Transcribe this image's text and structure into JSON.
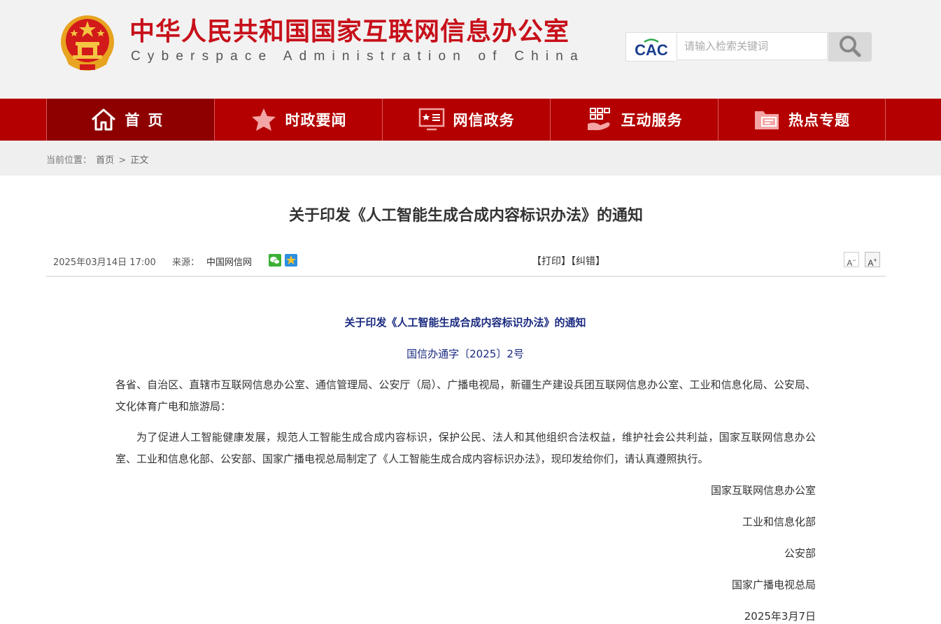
{
  "header": {
    "title_cn": "中华人民共和国国家互联网信息办公室",
    "title_en": "Cyberspace Administration of China",
    "search_logo": "CAC",
    "search_placeholder": "请输入检索关键词",
    "emblem_icon": "national-emblem-icon",
    "search_icon": "search-icon"
  },
  "colors": {
    "brand_red": "#c7101a",
    "nav_bg": "#b40000",
    "nav_active": "#8e0000",
    "doc_blue": "#1a2a80"
  },
  "nav": {
    "items": [
      {
        "label": "首页",
        "icon": "home-icon"
      },
      {
        "label": "时政要闻",
        "icon": "star-icon"
      },
      {
        "label": "网信政务",
        "icon": "monitor-icon"
      },
      {
        "label": "互动服务",
        "icon": "service-hand-icon"
      },
      {
        "label": "热点专题",
        "icon": "folder-icon"
      }
    ]
  },
  "breadcrumb": {
    "prefix": "当前位置：",
    "home": "首页",
    "sep": ">",
    "current": "正文"
  },
  "article": {
    "title": "关于印发《人工智能生成合成内容标识办法》的通知",
    "date": "2025年03月14日 17:00",
    "source_label": "来源：",
    "source": "中国网信网",
    "print": "【打印】",
    "correct": "【纠错】",
    "font_minus": "A",
    "font_plus": "A",
    "doc_title": "关于印发《人工智能生成合成内容标识办法》的通知",
    "doc_no": "国信办通字〔2025〕2号",
    "para1": "各省、自治区、直辖市互联网信息办公室、通信管理局、公安厅（局）、广播电视局，新疆生产建设兵团互联网信息办公室、工业和信息化局、公安局、文化体育广电和旅游局：",
    "para2": "为了促进人工智能健康发展，规范人工智能生成合成内容标识，保护公民、法人和其他组织合法权益，维护社会公共利益，国家互联网信息办公室、工业和信息化部、公安部、国家广播电视总局制定了《人工智能生成合成内容标识办法》，现印发给你们，请认真遵照执行。",
    "signatures": [
      "国家互联网信息办公室",
      "工业和信息化部",
      "公安部",
      "国家广播电视总局"
    ],
    "sign_date": "2025年3月7日"
  }
}
